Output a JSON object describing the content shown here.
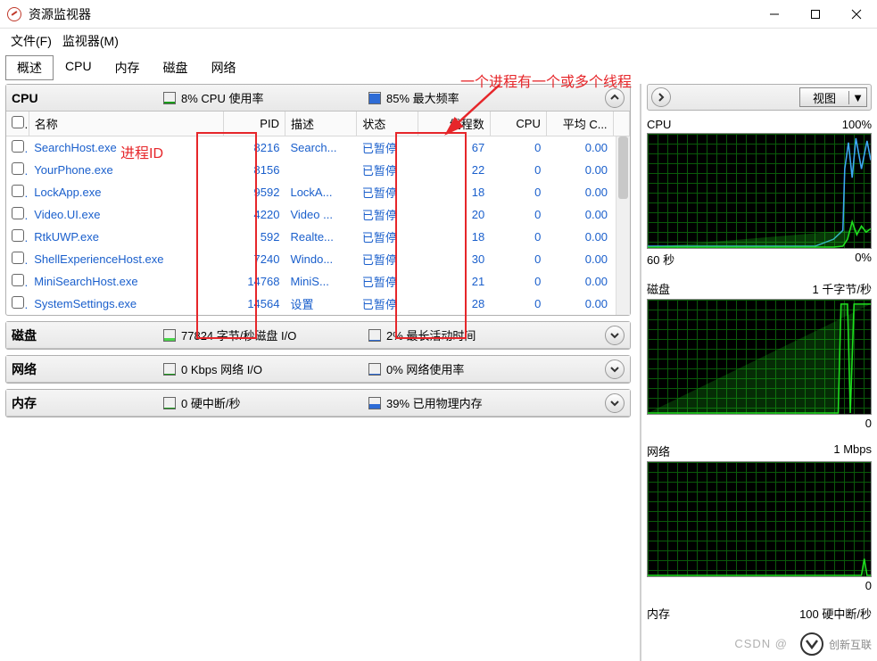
{
  "window": {
    "title": "资源监视器"
  },
  "menu": {
    "file": "文件(F)",
    "monitor": "监视器(M)"
  },
  "tabs": {
    "overview": "概述",
    "cpu": "CPU",
    "memory": "内存",
    "disk": "磁盘",
    "network": "网络"
  },
  "annotations": {
    "thread_note": "一个进程有一个或多个线程",
    "pid_note": "进程ID"
  },
  "cpu_section": {
    "title": "CPU",
    "usage_label": "8% CPU 使用率",
    "freq_label": "85% 最大频率",
    "columns": {
      "name": "名称",
      "pid": "PID",
      "desc": "描述",
      "status": "状态",
      "threads": "线程数",
      "cpu": "CPU",
      "avg": "平均 C..."
    },
    "rows": [
      {
        "name": "SearchHost.exe",
        "pid": "8216",
        "desc": "Search...",
        "status": "已暂停",
        "threads": "67",
        "cpu": "0",
        "avg": "0.00"
      },
      {
        "name": "YourPhone.exe",
        "pid": "8156",
        "desc": "",
        "status": "已暂停",
        "threads": "22",
        "cpu": "0",
        "avg": "0.00"
      },
      {
        "name": "LockApp.exe",
        "pid": "9592",
        "desc": "LockA...",
        "status": "已暂停",
        "threads": "18",
        "cpu": "0",
        "avg": "0.00"
      },
      {
        "name": "Video.UI.exe",
        "pid": "4220",
        "desc": "Video ...",
        "status": "已暂停",
        "threads": "20",
        "cpu": "0",
        "avg": "0.00"
      },
      {
        "name": "RtkUWP.exe",
        "pid": "592",
        "desc": "Realte...",
        "status": "已暂停",
        "threads": "18",
        "cpu": "0",
        "avg": "0.00"
      },
      {
        "name": "ShellExperienceHost.exe",
        "pid": "7240",
        "desc": "Windo...",
        "status": "已暂停",
        "threads": "30",
        "cpu": "0",
        "avg": "0.00"
      },
      {
        "name": "MiniSearchHost.exe",
        "pid": "14768",
        "desc": "MiniS...",
        "status": "已暂停",
        "threads": "21",
        "cpu": "0",
        "avg": "0.00"
      },
      {
        "name": "SystemSettings.exe",
        "pid": "14564",
        "desc": "设置",
        "status": "已暂停",
        "threads": "28",
        "cpu": "0",
        "avg": "0.00"
      }
    ]
  },
  "disk_section": {
    "title": "磁盘",
    "io_label": "77824 字节/秒磁盘 I/O",
    "act_label": "2% 最长活动时间"
  },
  "net_section": {
    "title": "网络",
    "io_label": "0 Kbps 网络 I/O",
    "use_label": "0% 网络使用率"
  },
  "mem_section": {
    "title": "内存",
    "hard_label": "0 硬中断/秒",
    "phys_label": "39% 已用物理内存"
  },
  "right": {
    "view_label": "视图",
    "graphs": {
      "cpu": {
        "title": "CPU",
        "top": "100%",
        "bottom_left": "60 秒",
        "bottom_right": "0%"
      },
      "disk": {
        "title": "磁盘",
        "top": "1 千字节/秒",
        "bottom_right": "0"
      },
      "network": {
        "title": "网络",
        "top": "1 Mbps",
        "bottom_right": "0"
      },
      "memory": {
        "title": "内存",
        "top": "100 硬中断/秒"
      }
    }
  },
  "watermark": {
    "csdn": "CSDN @",
    "brand": "创新互联"
  }
}
